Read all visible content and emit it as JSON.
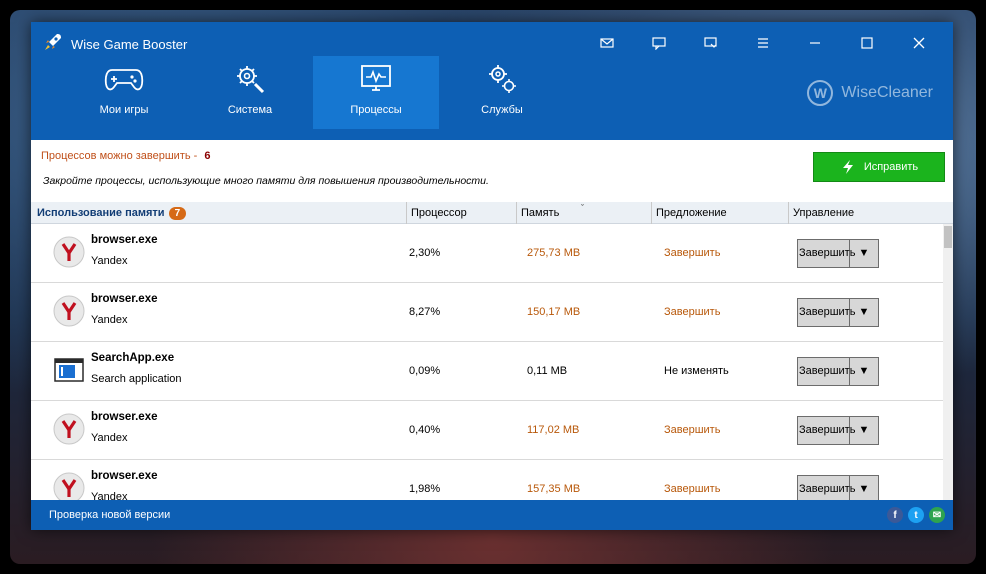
{
  "app": {
    "title": "Wise Game Booster",
    "brand": "WiseCleaner",
    "brand_letter": "W"
  },
  "nav": [
    {
      "label": "Мои игры",
      "icon": "gamepad-icon",
      "active": false
    },
    {
      "label": "Система",
      "icon": "tools-icon",
      "active": false
    },
    {
      "label": "Процессы",
      "icon": "monitor-icon",
      "active": true
    },
    {
      "label": "Службы",
      "icon": "gears-icon",
      "active": false
    }
  ],
  "info": {
    "line1": "Процессов можно завершить -",
    "count": "6",
    "line2": "Закройте процессы, использующие много памяти для повышения производительности.",
    "fix_button": "Исправить"
  },
  "table": {
    "headers": {
      "memory_usage": "Использование памяти",
      "badge": "7",
      "cpu": "Процессор",
      "memory": "Память",
      "suggestion": "Предложение",
      "control": "Управление"
    },
    "rows": [
      {
        "name": "browser.exe",
        "desc": "Yandex",
        "cpu": "2,30%",
        "mem": "275,73 MB",
        "suggestion": "Завершить",
        "control": "Завершить",
        "icon": "yandex-icon",
        "highlight": true
      },
      {
        "name": "browser.exe",
        "desc": "Yandex",
        "cpu": "8,27%",
        "mem": "150,17 MB",
        "suggestion": "Завершить",
        "control": "Завершить",
        "icon": "yandex-icon",
        "highlight": true
      },
      {
        "name": "SearchApp.exe",
        "desc": "Search application",
        "cpu": "0,09%",
        "mem": "0,11 MB",
        "suggestion": "Не изменять",
        "control": "Завершить",
        "icon": "window-app-icon",
        "highlight": false
      },
      {
        "name": "browser.exe",
        "desc": "Yandex",
        "cpu": "0,40%",
        "mem": "117,02 MB",
        "suggestion": "Завершить",
        "control": "Завершить",
        "icon": "yandex-icon",
        "highlight": true
      },
      {
        "name": "browser.exe",
        "desc": "Yandex",
        "cpu": "1,98%",
        "mem": "157,35 MB",
        "suggestion": "Завершить",
        "control": "Завершить",
        "icon": "yandex-icon",
        "highlight": true
      }
    ]
  },
  "status": {
    "update_text": "Проверка новой версии"
  },
  "colors": {
    "titlebar": "#0d5fb4",
    "active_tab": "#1677d1",
    "fix_button": "#1bb41d",
    "badge": "#d66a17",
    "accent_text": "#b8580a"
  }
}
